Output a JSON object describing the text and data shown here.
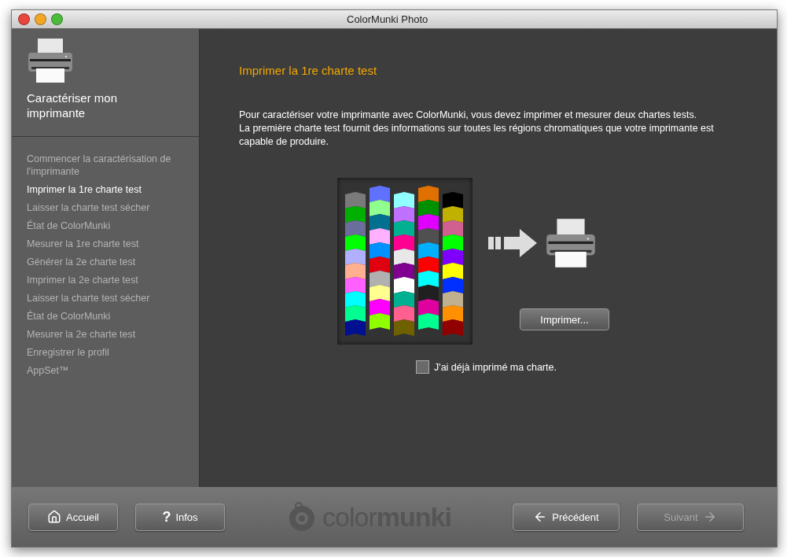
{
  "window": {
    "title": "ColorMunki Photo"
  },
  "sidebar": {
    "heading": "Caractériser mon imprimante",
    "items": [
      {
        "label": "Commencer la caractérisation de l'imprimante",
        "selected": false
      },
      {
        "label": "Imprimer la 1re charte test",
        "selected": true
      },
      {
        "label": "Laisser la charte test sécher",
        "selected": false
      },
      {
        "label": "État de ColorMunki",
        "selected": false
      },
      {
        "label": "Mesurer la 1re charte test",
        "selected": false
      },
      {
        "label": "Générer la 2e charte test",
        "selected": false
      },
      {
        "label": "Imprimer la 2e charte test",
        "selected": false
      },
      {
        "label": "Laisser la charte test sécher",
        "selected": false
      },
      {
        "label": "État de ColorMunki",
        "selected": false
      },
      {
        "label": "Mesurer la 2e charte test",
        "selected": false
      },
      {
        "label": "Enregistrer le profil",
        "selected": false
      },
      {
        "label": "AppSet™",
        "selected": false
      }
    ]
  },
  "main": {
    "title": "Imprimer la 1re charte test",
    "paragraphs": [
      "Pour caractériser votre imprimante avec ColorMunki, vous devez imprimer et mesurer deux chartes tests.",
      "La première charte test fournit des informations sur toutes les régions chromatiques que votre imprimante est capable de produire."
    ],
    "print_button": "Imprimer...",
    "checkbox": {
      "label": "J'ai déjà imprimé ma charte.",
      "checked": false
    }
  },
  "footer": {
    "buttons": [
      {
        "kind": "home",
        "label": "Accueil",
        "disabled": false
      },
      {
        "kind": "help",
        "icon_text": "?",
        "label": "Infos",
        "disabled": false
      },
      {
        "kind": "back",
        "label": "Précédent",
        "disabled": false
      },
      {
        "kind": "next",
        "label": "Suivant",
        "disabled": true
      }
    ],
    "logo": "color**munki**"
  }
}
